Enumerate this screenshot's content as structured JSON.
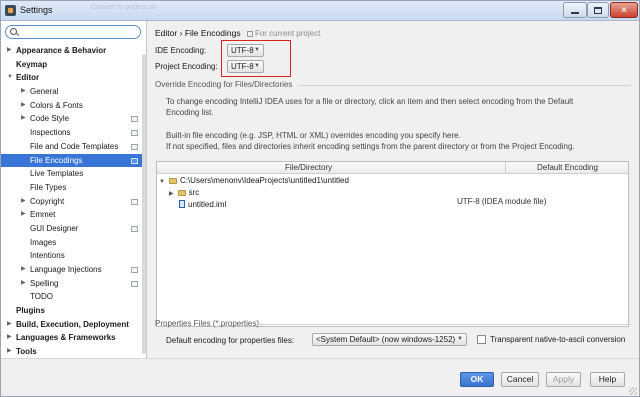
{
  "window": {
    "title": "Settings",
    "title_ghost": "Convert to project.sln",
    "minimize_glyph": "–",
    "maximize_glyph": "□",
    "close_glyph": "✕"
  },
  "sidebar": {
    "search_placeholder": "",
    "items": [
      {
        "label": "Appearance & Behavior",
        "bold": true,
        "arrow": "▶",
        "level": 0
      },
      {
        "label": "Keymap",
        "bold": true,
        "arrow": "",
        "level": 0
      },
      {
        "label": "Editor",
        "bold": true,
        "arrow": "▼",
        "level": 0
      },
      {
        "label": "General",
        "bold": false,
        "arrow": "▶",
        "level": 1
      },
      {
        "label": "Colors & Fonts",
        "bold": false,
        "arrow": "▶",
        "level": 1
      },
      {
        "label": "Code Style",
        "bold": false,
        "arrow": "▶",
        "level": 1,
        "scope": true
      },
      {
        "label": "Inspections",
        "bold": false,
        "arrow": "",
        "level": 1,
        "scope": true
      },
      {
        "label": "File and Code Templates",
        "bold": false,
        "arrow": "",
        "level": 1,
        "scope": true
      },
      {
        "label": "File Encodings",
        "bold": false,
        "arrow": "",
        "level": 1,
        "scope": true,
        "selected": true
      },
      {
        "label": "Live Templates",
        "bold": false,
        "arrow": "",
        "level": 1
      },
      {
        "label": "File Types",
        "bold": false,
        "arrow": "",
        "level": 1
      },
      {
        "label": "Copyright",
        "bold": false,
        "arrow": "▶",
        "level": 1,
        "scope": true
      },
      {
        "label": "Emmet",
        "bold": false,
        "arrow": "▶",
        "level": 1
      },
      {
        "label": "GUI Designer",
        "bold": false,
        "arrow": "",
        "level": 1,
        "scope": true
      },
      {
        "label": "Images",
        "bold": false,
        "arrow": "",
        "level": 1
      },
      {
        "label": "Intentions",
        "bold": false,
        "arrow": "",
        "level": 1
      },
      {
        "label": "Language Injections",
        "bold": false,
        "arrow": "▶",
        "level": 1,
        "scope": true
      },
      {
        "label": "Spelling",
        "bold": false,
        "arrow": "▶",
        "level": 1,
        "scope": true
      },
      {
        "label": "TODO",
        "bold": false,
        "arrow": "",
        "level": 1
      },
      {
        "label": "Plugins",
        "bold": true,
        "arrow": "",
        "level": 0
      },
      {
        "label": "Build, Execution, Deployment",
        "bold": true,
        "arrow": "▶",
        "level": 0
      },
      {
        "label": "Languages & Frameworks",
        "bold": true,
        "arrow": "▶",
        "level": 0
      },
      {
        "label": "Tools",
        "bold": true,
        "arrow": "▶",
        "level": 0
      }
    ]
  },
  "main": {
    "breadcrumb_section": "Editor",
    "breadcrumb_sep": "›",
    "breadcrumb_page": "File Encodings",
    "breadcrumb_scope": "For current project",
    "ide_encoding_label": "IDE Encoding:",
    "ide_encoding_value": "UTF-8",
    "project_encoding_label": "Project Encoding:",
    "project_encoding_value": "UTF-8",
    "override_title": "Override Encoding for Files/Directories",
    "hint_line1": "To change encoding IntelliJ IDEA uses for a file or directory, click an item and then select encoding from the Default",
    "hint_line2": "Encoding list.",
    "hint_line3": "Built-in file encoding (e.g. JSP, HTML or XML) overrides encoding you specify here.",
    "hint_line4": "If not specified, files and directories inherit encoding settings from the parent directory or from the Project Encoding.",
    "table": {
      "col_file": "File/Directory",
      "col_encoding": "Default Encoding",
      "root": "C:\\Users\\menonv\\IdeaProjects\\untitled1\\untitled",
      "src": "src",
      "file": "untitled.iml",
      "file_encoding": "UTF-8 (IDEA module file)"
    },
    "props_title": "Properties Files (*.properties)",
    "props_label": "Default encoding for properties files:",
    "props_value": "<System Default> (now windows-1252)",
    "transparent_label": "Transparent native-to-ascii conversion",
    "transparent_checked": false
  },
  "footer": {
    "ok": "OK",
    "cancel": "Cancel",
    "apply": "Apply",
    "help": "Help"
  }
}
